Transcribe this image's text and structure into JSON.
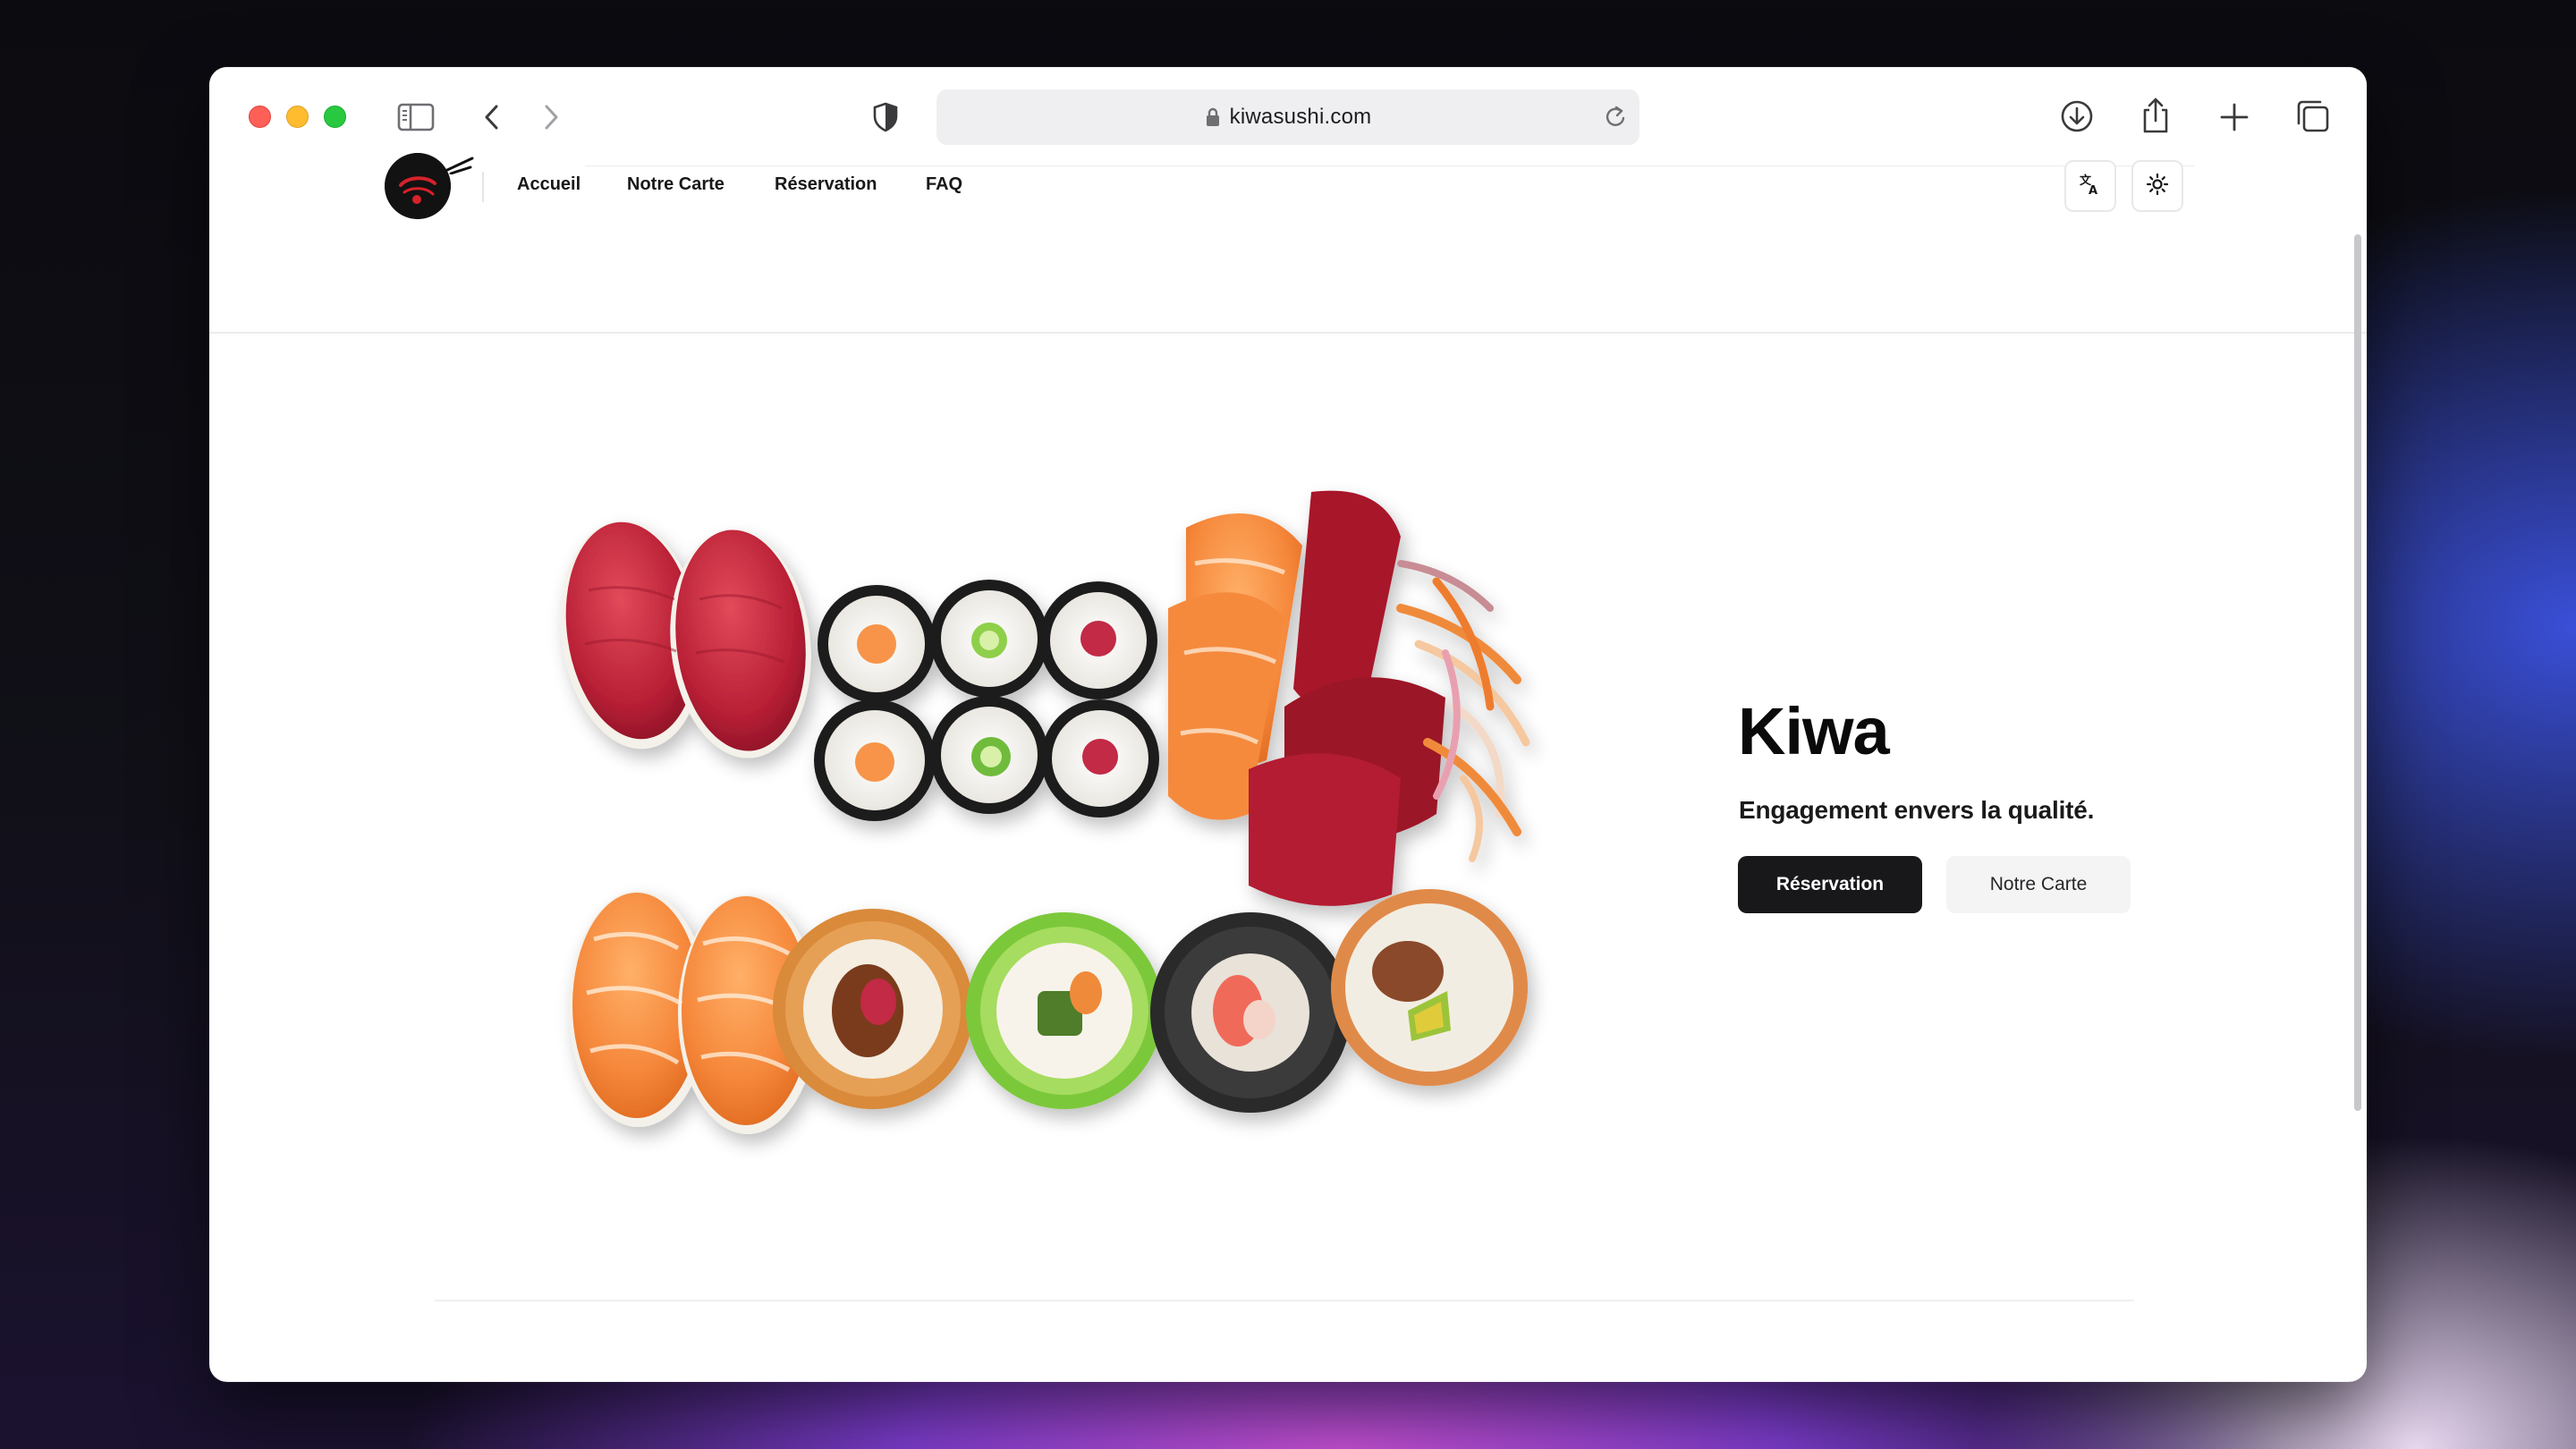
{
  "browser": {
    "url": "kiwasushi.com",
    "icons": [
      "sidebar-icon",
      "back-icon",
      "forward-icon",
      "privacy-shield-icon",
      "lock-icon",
      "reload-icon",
      "download-icon",
      "share-icon",
      "new-tab-icon",
      "tab-overview-icon"
    ]
  },
  "nav": {
    "links": [
      "Accueil",
      "Notre Carte",
      "Réservation",
      "FAQ"
    ],
    "icon_buttons": [
      "translate-icon",
      "theme-toggle-icon"
    ]
  },
  "hero": {
    "title": "Kiwa",
    "subtitle": "Engagement envers la qualité.",
    "primary_cta": "Réservation",
    "secondary_cta": "Notre Carte"
  },
  "colors": {
    "primary_button": "#18181b",
    "secondary_button": "#f4f4f5",
    "logo_accent": "#d6222a"
  }
}
